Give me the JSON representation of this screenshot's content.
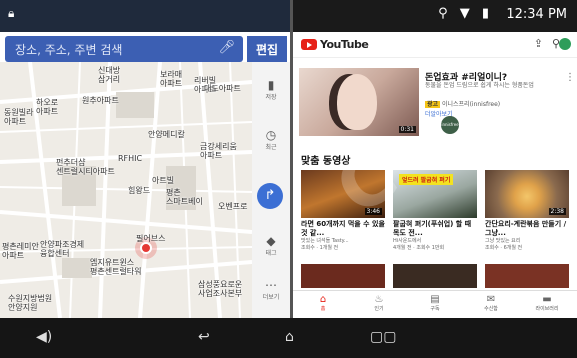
{
  "status": {
    "time": "12:34 PM",
    "icons": "⚲ ▼ ▮"
  },
  "map": {
    "search_placeholder": "장소, 주소, 주변 검색",
    "edit_label": "편집",
    "pois": [
      "신대방\n삼거리",
      "보라매\n아파트",
      "리버빌\n아파트",
      "대도아파트",
      "하오로\n아파트",
      "원추아파트",
      "동원빌라\n아파트",
      "안양메디칼",
      "금강세리움\n아파트",
      "펀추더샵\n센트럴시티아파트",
      "RFHIC",
      "힘왕드",
      "아트빌",
      "평촌\n스마트베이",
      "오벤프로",
      "안양파조경제\n융합센터",
      "평촌레미안\n아파트",
      "필어브스",
      "엠지유트윈스\n평촌센트럴타워",
      "수원지방법원\n안양지원",
      "삼성풍요로운\n사업조사본부"
    ],
    "rail": [
      {
        "icon": "bookmark-icon",
        "glyph": "▮",
        "label": "저장"
      },
      {
        "icon": "clock-icon",
        "glyph": "◷",
        "label": "최근"
      },
      {
        "icon": "tag-icon",
        "glyph": "◆",
        "label": "태그"
      },
      {
        "icon": "more-icon",
        "glyph": "⋯",
        "label": "더보기"
      }
    ],
    "directions_glyph": "↱",
    "compass_glyph": "▲",
    "locate_glyph": "⊙"
  },
  "youtube": {
    "brand": "YouTube",
    "featured": {
      "title": "돈업효과 #리얼이니?",
      "subtitle": "동물을 돈업 드림으로 쉽게 하시는 형품돈업",
      "ad_badge": "광고",
      "ad_text": "이니스프리(innisfree)",
      "link": "더알아보기",
      "duration": "0:31",
      "channel": "innisfree"
    },
    "section_title": "맞춤 동영상",
    "videos": [
      {
        "title": "라면 60개까지 먹을 수 있을 것 같...",
        "meta": "맛있는 녀석들 Tasty...\n조회수 · 1개월 전",
        "duration": "3:46",
        "label": ""
      },
      {
        "title": "팔굽혀 펴기(푸쉬업) 할 때 목도 전...",
        "meta": "Hi사운드에서\n4개월 전 · 조회수 1만회",
        "duration": "",
        "label": "엎드려 팔굽혀 펴기"
      },
      {
        "title": "간단요리-계란볶음 만들기 / 그냥...",
        "meta": "그냥 맛있는 요리\n조회수 · 6개월 전",
        "duration": "2:38",
        "label": ""
      }
    ],
    "nav": [
      {
        "label": "홈",
        "icon": "home-icon",
        "glyph": "⌂",
        "active": true
      },
      {
        "label": "인기",
        "icon": "fire-icon",
        "glyph": "♨",
        "active": false
      },
      {
        "label": "구독",
        "icon": "subscriptions-icon",
        "glyph": "▤",
        "active": false
      },
      {
        "label": "수신함",
        "icon": "inbox-icon",
        "glyph": "✉",
        "active": false
      },
      {
        "label": "라이브러리",
        "icon": "library-icon",
        "glyph": "▬",
        "active": false
      }
    ]
  },
  "system_nav": {
    "volume": "◀)",
    "back": "↩",
    "home": "⌂",
    "recents": "▢▢"
  }
}
